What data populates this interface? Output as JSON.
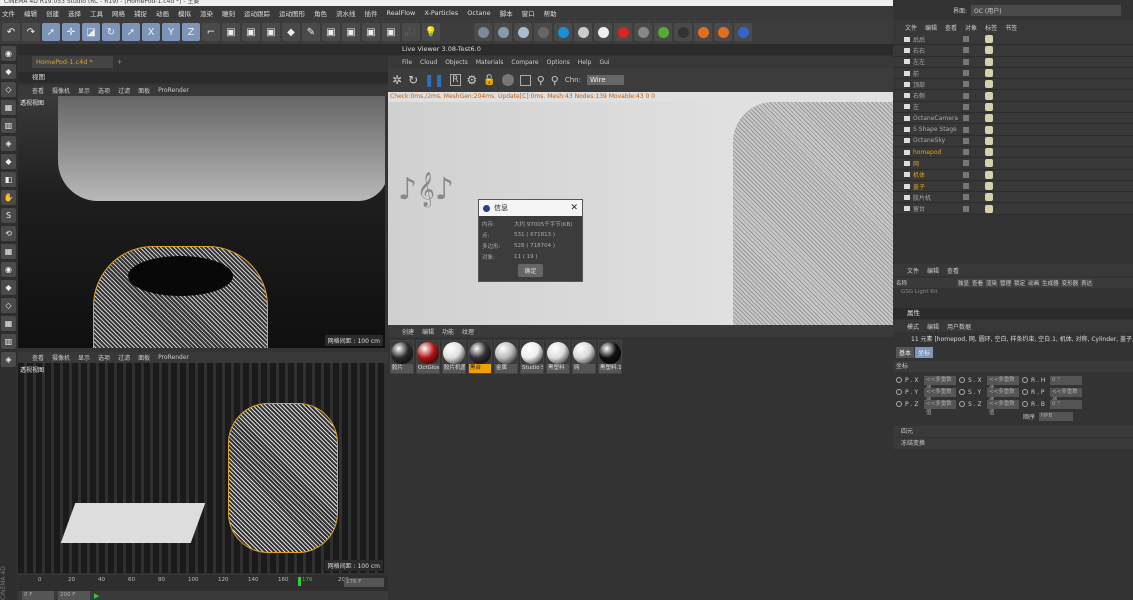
{
  "app": {
    "title": "CINEMA 4D R19.053 Studio (RC - R19) - [HomePod-1.c4d *] - 主要"
  },
  "menubar": [
    "文件",
    "编辑",
    "创建",
    "选择",
    "工具",
    "网格",
    "捕捉",
    "动画",
    "模拟",
    "渲染",
    "雕刻",
    "运动跟踪",
    "运动图形",
    "角色",
    "流水线",
    "插件",
    "RealFlow",
    "X-Particles",
    "Octane",
    "脚本",
    "窗口",
    "帮助"
  ],
  "toolbar": {
    "icons": [
      "undo-icon",
      "redo-icon",
      "select-icon",
      "move-icon",
      "scale-icon",
      "rotate-icon",
      "live-select-icon",
      "x-axis-icon",
      "y-axis-icon",
      "z-axis-icon",
      "coordinate-icon",
      "render-view-icon",
      "render-picture-icon",
      "render-settings-icon",
      "cube-icon",
      "pen-icon",
      "subdivision-icon",
      "cloner-icon",
      "deformer-icon",
      "floor-icon",
      "camera-icon",
      "light-icon"
    ],
    "axis_labels": [
      "X",
      "Y",
      "Z"
    ],
    "octane_icons": [
      "octane-diffuse-icon",
      "octane-glossy-icon",
      "octane-specular-icon",
      "octane-mix-icon",
      "octane-sky-icon",
      "octane-hdri-icon",
      "octane-area-light-icon",
      "octane-camera-icon",
      "octane-scatter-icon",
      "octane-cycle-icon",
      "octane-s-icon",
      "octane-s-orange-icon",
      "octane-expand-icon",
      "octane-import-icon"
    ]
  },
  "document": {
    "tab": "HomePod-1.c4d *",
    "add_tab": "+"
  },
  "viewport_panel": {
    "title": "视图",
    "menu": [
      "查看",
      "摄像机",
      "显示",
      "选项",
      "过滤",
      "面板",
      "ProRender"
    ],
    "top": {
      "label": "透视视图",
      "grid": "网格间距 : 100 cm"
    },
    "bottom": {
      "label": "透视视图",
      "grid": "网格间距 : 100 cm"
    }
  },
  "timeline": {
    "ticks": [
      "0",
      "20",
      "40",
      "60",
      "80",
      "100",
      "120",
      "140",
      "160",
      "176",
      "200"
    ],
    "current_frame": "176 F",
    "start": "0 F",
    "end": "200 F",
    "current": 176,
    "max": 200
  },
  "live_viewer": {
    "title": "Live Viewer 3.08-Test6.0",
    "menu": [
      "File",
      "Cloud",
      "Objects",
      "Materials",
      "Compare",
      "Options",
      "Help",
      "Gui"
    ],
    "channel_label": "Chn:",
    "channel_value": "Wire",
    "status": "Check:0ms./2ms. MeshGen:204ms. Update[C]:0ms. Mesh:43 Nodes:139 Movable:43  0 0"
  },
  "info_dialog": {
    "title": "信息",
    "rows": [
      {
        "label": "内存:",
        "value": "大约 97005千字节(KB)"
      },
      {
        "label": "点:",
        "value": "531 ( 671813 )"
      },
      {
        "label": "多边形:",
        "value": "528 ( 718704 )"
      },
      {
        "label": "对象:",
        "value": "11 ( 19 )"
      }
    ],
    "ok": "确定"
  },
  "materials": {
    "menu": [
      "创建",
      "编辑",
      "功能",
      "纹理"
    ],
    "items": [
      {
        "name": "胶片",
        "color": "#2a2a2a"
      },
      {
        "name": "OctGlos",
        "color": "#b01515"
      },
      {
        "name": "胶片机盖",
        "color": "#e0e0e0"
      },
      {
        "name": "黑台",
        "color": "#303030",
        "selected": true
      },
      {
        "name": "金属",
        "color": "#bbbbbb"
      },
      {
        "name": "Studio S",
        "color": "#eeeeee"
      },
      {
        "name": "黑塑料",
        "color": "#dddddd"
      },
      {
        "name": "网",
        "color": "#d8d8d8"
      },
      {
        "name": "黑塑料.1",
        "color": "#111111"
      }
    ]
  },
  "right": {
    "layout_label": "界面:",
    "layout_value": "OC (用户)",
    "objects_menu": [
      "文件",
      "编辑",
      "查看",
      "对象",
      "标签",
      "书签"
    ],
    "objects": [
      {
        "name": "后后",
        "color": "#aaaaaa"
      },
      {
        "name": "右右",
        "color": "#aaaaaa"
      },
      {
        "name": "左左",
        "color": "#aaaaaa"
      },
      {
        "name": "前",
        "color": "#aaaaaa"
      },
      {
        "name": "顶部",
        "color": "#aaaaaa"
      },
      {
        "name": "右侧",
        "color": "#aaaaaa"
      },
      {
        "name": "左",
        "color": "#aaaaaa"
      },
      {
        "name": "OctaneCamera",
        "color": "#aaaaaa"
      },
      {
        "name": "S Shape Stage",
        "color": "#aaaaaa"
      },
      {
        "name": "OctaneSky",
        "color": "#aaaaaa"
      },
      {
        "name": "homepod",
        "color": "#e0a020"
      },
      {
        "name": "网",
        "color": "#e0a020"
      },
      {
        "name": "机体",
        "color": "#e0a020"
      },
      {
        "name": "盖子",
        "color": "#e0a020"
      },
      {
        "name": "胶片机",
        "color": "#aaaaaa"
      },
      {
        "name": "留台",
        "color": "#aaaaaa"
      }
    ],
    "layers_menu": [
      "文件",
      "编辑",
      "查看"
    ],
    "layers_columns": [
      "名称",
      "独显",
      "查看",
      "渲染",
      "管理",
      "锁定",
      "动画",
      "生成器",
      "变形器",
      "表达"
    ],
    "layers_row": "GSG Light Kit",
    "attr_title": "属性",
    "attr_menu": [
      "模式",
      "编辑",
      "用户数据"
    ],
    "attr_summary": "11 元素 [homepod, 网, 圆环, 空白, 样条约束, 空白.1, 机体, 对称, Cylinder, 盖子, 圆",
    "attr_tabs": [
      "基本",
      "坐标"
    ],
    "coord_title": "坐标",
    "coords": [
      [
        {
          "label": "P . X",
          "value": "<<多重数值"
        },
        {
          "label": "S . X",
          "value": "<<多重数值"
        },
        {
          "label": "R . H",
          "value": "0 °"
        }
      ],
      [
        {
          "label": "P . Y",
          "value": "<<多重数值"
        },
        {
          "label": "S . Y",
          "value": "<<多重数值"
        },
        {
          "label": "R . P",
          "value": "<<多重数值"
        }
      ],
      [
        {
          "label": "P . Z",
          "value": "<<多重数值"
        },
        {
          "label": "S . Z",
          "value": "<<多重数值"
        },
        {
          "label": "R . B",
          "value": "0 °"
        }
      ]
    ],
    "order_label": "顺序",
    "order_value": "HPB",
    "sections": [
      "四元",
      "冻结变换"
    ]
  },
  "brand": "CINEMA 4D",
  "colors": {
    "accent_orange": "#e0a020",
    "selection_blue": "#7d95b8",
    "status_orange": "#d07020"
  }
}
